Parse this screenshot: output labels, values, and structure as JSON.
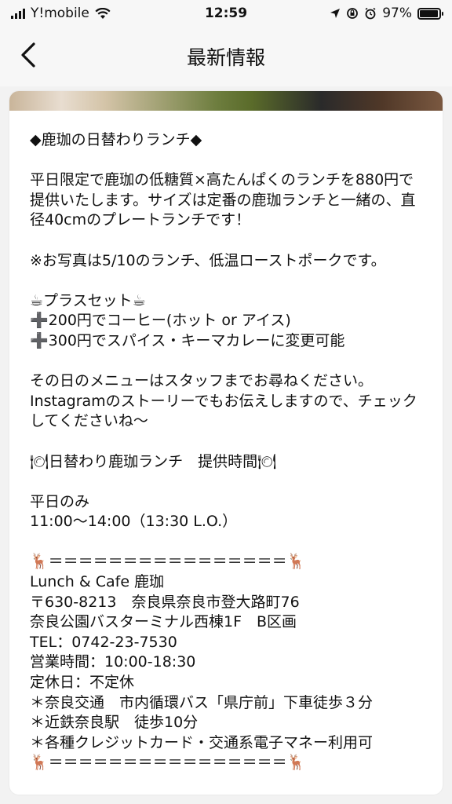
{
  "status_bar": {
    "carrier": "Y!mobile",
    "time": "12:59",
    "battery": "97%",
    "battery_level": 0.97
  },
  "nav": {
    "back_label": "<",
    "title": "最新情報"
  },
  "post": {
    "lines": [
      "◆鹿珈の日替わりランチ◆",
      "",
      "平日限定で鹿珈の低糖質×高たんぱくのランチを880円で提供いたします。サイズは定番の鹿珈ランチと一緒の、直径40cmのプレートランチです！",
      "",
      "※お写真は5/10のランチ、低温ローストポークです。",
      "",
      "☕プラスセット☕",
      "➕200円でコーヒー(ホット or アイス)",
      "➕300円でスパイス・キーマカレーに変更可能",
      "",
      "その日のメニューはスタッフまでお尋ねください。Instagramのストーリーでもお伝えしますので、チェックしてくださいね〜",
      "",
      "🍽日替わり鹿珈ランチ　提供時間🍽",
      "",
      "平日のみ",
      "11:00〜14:00（13:30 L.O.）",
      "",
      "🦌＝＝＝＝＝＝＝＝＝＝＝＝＝＝＝＝🦌",
      "Lunch & Cafe 鹿珈",
      "〒630-8213　奈良県奈良市登大路町76",
      "奈良公園バスターミナル西棟1F　B区画",
      "TEL：0742-23-7530",
      "営業時間：10:00-18:30",
      "定休日：不定休",
      "＊奈良交通　市内循環バス「県庁前」下車徒歩３分",
      "＊近鉄奈良駅　徒歩10分",
      "＊各種クレジットカード・交通系電子マネー利用可",
      "🦌＝＝＝＝＝＝＝＝＝＝＝＝＝＝＝＝🦌"
    ]
  }
}
